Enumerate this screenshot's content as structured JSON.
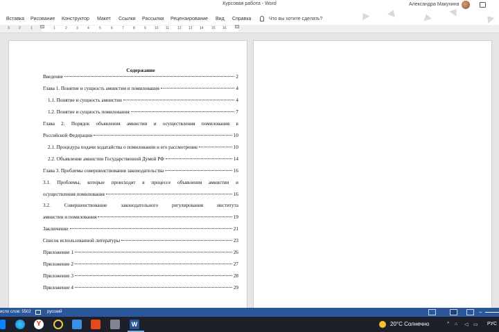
{
  "window": {
    "title": "Курсовая работа  -  Word",
    "user_name": "Александра Макухина"
  },
  "ribbon": {
    "tabs": [
      "Вставка",
      "Рисование",
      "Конструктор",
      "Макет",
      "Ссылки",
      "Рассылки",
      "Рецензирование",
      "Вид",
      "Справка"
    ],
    "tell_me": "Что вы хотите сделать?"
  },
  "ruler": {
    "left_numbers": [
      "3",
      "2",
      "1"
    ],
    "right_numbers": [
      "1",
      "2",
      "3",
      "4",
      "5",
      "6",
      "7",
      "8",
      "9",
      "10",
      "11",
      "12",
      "13",
      "14",
      "15",
      "16"
    ]
  },
  "document": {
    "toc_title": "Содержание",
    "entries": [
      {
        "text": "Введение",
        "page": "2"
      },
      {
        "text": "Глава 1. Понятие и сущность амнистии и помилования",
        "page": "4"
      },
      {
        "text": "1.1.  Понятие и сущность амнистии",
        "page": "4"
      },
      {
        "text": "1.2. Понятие и сущность помилования",
        "page": "7"
      },
      {
        "line1": "Глава 2. Порядок объявления амнистии и осуществления помилования в",
        "text": "Российской Федерации",
        "page": "10"
      },
      {
        "text": "2.1. Процедура подачи ходатайства о помиловании и его рассмотрение",
        "page": "10"
      },
      {
        "text": "2.2. Объявление амнистии Государственной Думой РФ",
        "page": "14"
      },
      {
        "text": "Глава 3. Проблемы совершенствования законодательства",
        "page": "16"
      },
      {
        "line1": "3.1. Проблемы, которые происходят в процессе объявления амнистии и",
        "text": "осуществления помилования",
        "page": "16"
      },
      {
        "line1": "3.2. Совершенствование законодательного регулирования института",
        "text": "амнистии и помилования",
        "page": "19"
      },
      {
        "text": "Заключение",
        "page": "21"
      },
      {
        "text": "Список использованной литературы",
        "page": "23"
      },
      {
        "text": "Приложение 1",
        "page": "26"
      },
      {
        "text": "Приложение 2",
        "page": "27"
      },
      {
        "text": "Приложение 3",
        "page": "28"
      },
      {
        "text": "Приложение 4",
        "page": "29"
      }
    ]
  },
  "statusbar": {
    "word_count": "исло слов: 5502",
    "language": "русский"
  },
  "taskbar": {
    "weather": "20°C  Солнечно",
    "input_language": "РУС"
  },
  "colors": {
    "status_bar": "#2b579a",
    "taskbar": "#1d1f2a",
    "word_icon": "#2b579a"
  }
}
